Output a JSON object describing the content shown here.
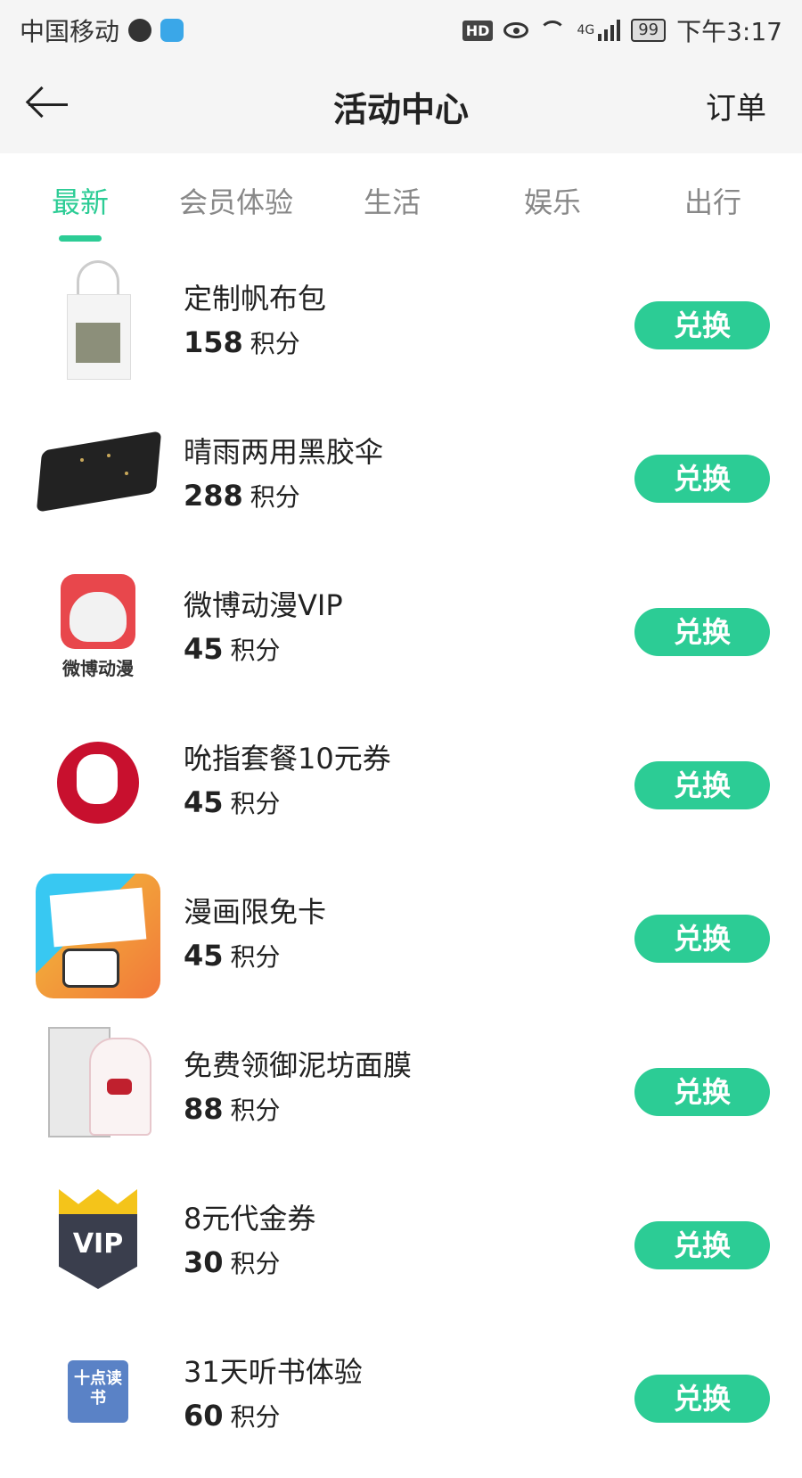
{
  "status_bar": {
    "carrier": "中国移动",
    "network": "4G",
    "battery": "99",
    "time": "下午3:17"
  },
  "header": {
    "title": "活动中心",
    "orders_label": "订单"
  },
  "tabs": [
    {
      "label": "最新",
      "active": true
    },
    {
      "label": "会员体验",
      "active": false
    },
    {
      "label": "生活",
      "active": false
    },
    {
      "label": "娱乐",
      "active": false
    },
    {
      "label": "出行",
      "active": false
    }
  ],
  "items": [
    {
      "title": "定制帆布包",
      "points": "158",
      "unit": "积分",
      "button": "兑换",
      "icon": "canvas-bag-icon"
    },
    {
      "title": "晴雨两用黑胶伞",
      "points": "288",
      "unit": "积分",
      "button": "兑换",
      "icon": "umbrella-icon"
    },
    {
      "title": "微博动漫VIP",
      "points": "45",
      "unit": "积分",
      "button": "兑换",
      "icon": "weibo-comics-icon",
      "icon_text": "微博动漫"
    },
    {
      "title": "吮指套餐10元券",
      "points": "45",
      "unit": "积分",
      "button": "兑换",
      "icon": "kfc-icon"
    },
    {
      "title": "漫画限免卡",
      "points": "45",
      "unit": "积分",
      "button": "兑换",
      "icon": "manhua-icon"
    },
    {
      "title": "免费领御泥坊面膜",
      "points": "88",
      "unit": "积分",
      "button": "兑换",
      "icon": "face-mask-icon"
    },
    {
      "title": "8元代金券",
      "points": "30",
      "unit": "积分",
      "button": "兑换",
      "icon": "vip-voucher-icon",
      "icon_text": "VIP"
    },
    {
      "title": "31天听书体验",
      "points": "60",
      "unit": "积分",
      "button": "兑换",
      "icon": "audiobook-icon",
      "icon_text": "十点读书"
    }
  ],
  "colors": {
    "accent": "#2ccc95",
    "header_bg": "#f5f5f5",
    "text": "#222222",
    "tab_inactive": "#888888"
  }
}
